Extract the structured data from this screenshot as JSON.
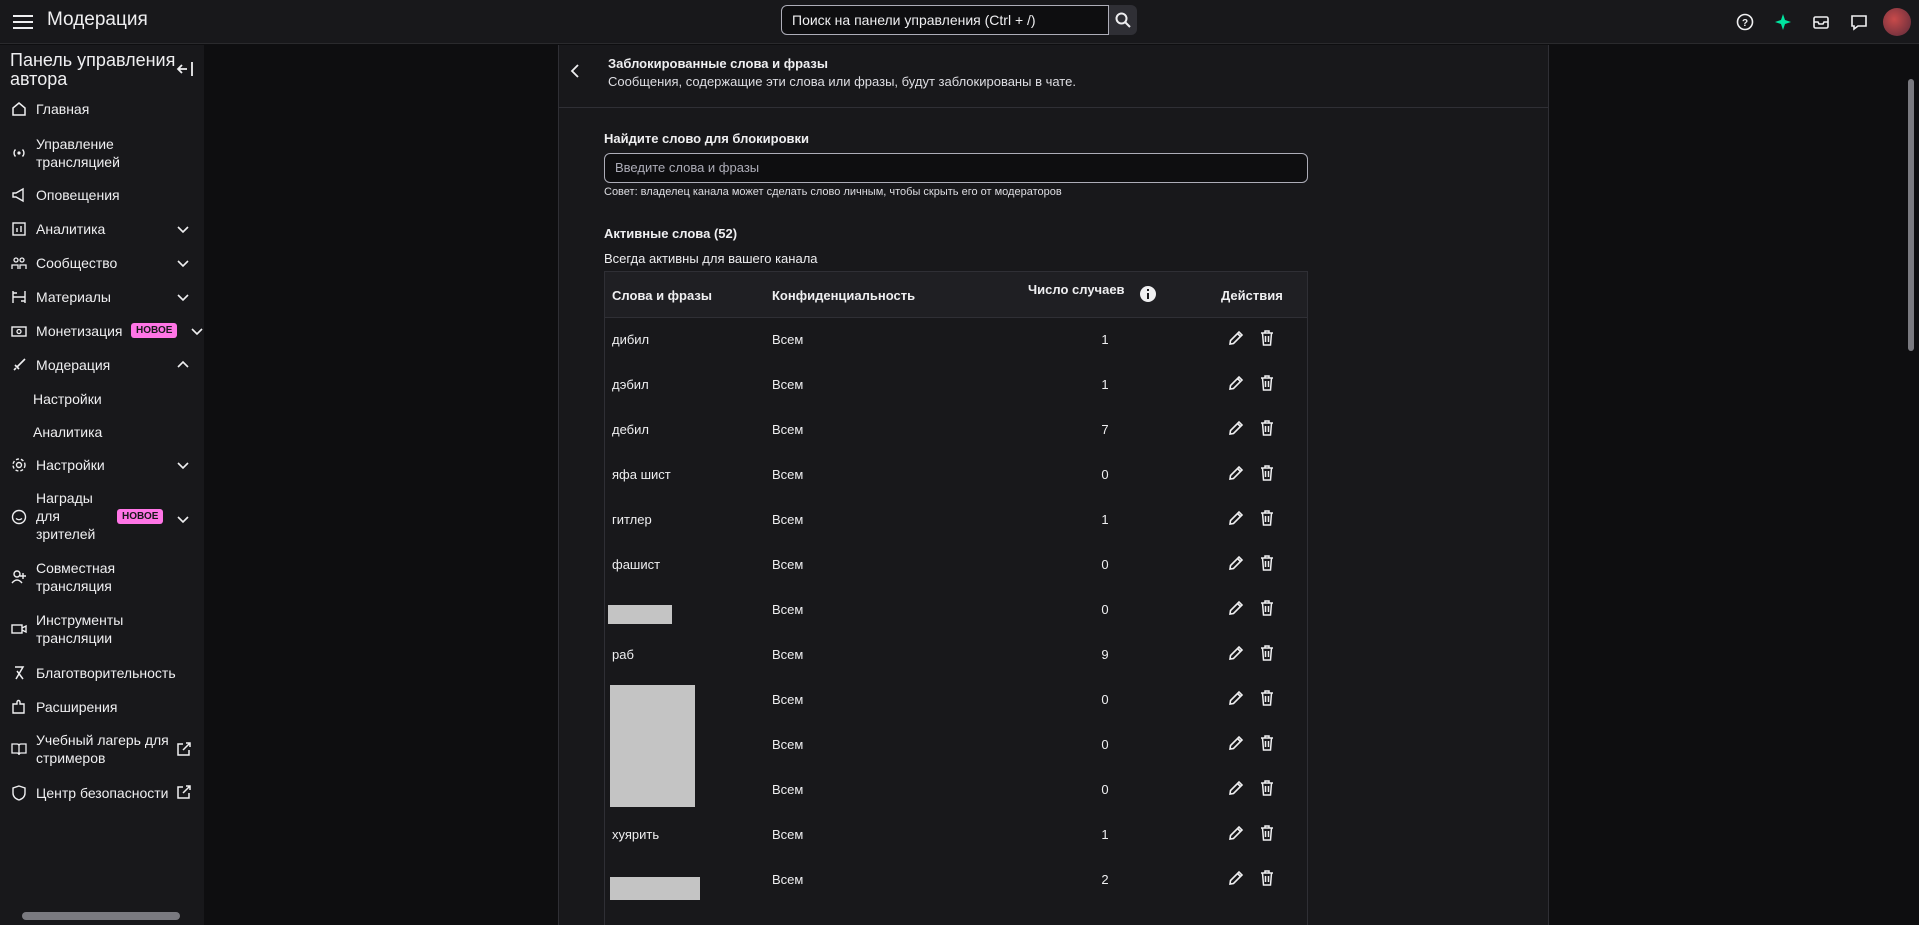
{
  "header": {
    "title": "Модерация",
    "search_placeholder": "Поиск на панели управления (Ctrl + /)",
    "icons": [
      "help-icon",
      "sparkle-icon",
      "inbox-icon",
      "whispers-icon",
      "avatar"
    ]
  },
  "sidebar": {
    "heading": "Панель управления автора",
    "items": [
      {
        "label": "Главная",
        "icon": "home-icon"
      },
      {
        "label": "Управление трансляцией",
        "icon": "broadcast-icon"
      },
      {
        "label": "Оповещения",
        "icon": "megaphone-icon"
      },
      {
        "label": "Аналитика",
        "icon": "analytics-icon"
      },
      {
        "label": "Сообщество",
        "icon": "community-icon"
      },
      {
        "label": "Материалы",
        "icon": "content-icon"
      },
      {
        "label": "Монетизация",
        "icon": "money-icon",
        "badge": "НОВОЕ"
      },
      {
        "label": "Модерация",
        "icon": "sword-icon"
      },
      {
        "label": "Настройки",
        "icon": "gear-icon"
      },
      {
        "label": "Награды для зрителей",
        "icon": "smile-icon",
        "badge": "НОВОЕ"
      },
      {
        "label": "Совместная трансляция",
        "icon": "add-user-icon"
      },
      {
        "label": "Инструменты трансляции",
        "icon": "camera-icon"
      },
      {
        "label": "Благотворительность",
        "icon": "ribbon-icon"
      },
      {
        "label": "Расширения",
        "icon": "puzzle-icon"
      },
      {
        "label": "Учебный лагерь для стримеров",
        "icon": "book-icon"
      },
      {
        "label": "Центр безопасности",
        "icon": "shield-icon"
      }
    ],
    "moderation_sub": [
      "Настройки",
      "Аналитика"
    ]
  },
  "panel": {
    "title": "Заблокированные слова и фразы",
    "subtitle": "Сообщения, содержащие эти слова или фразы, будут заблокированы в чате.",
    "find_label": "Найдите слово для блокировки",
    "input_placeholder": "Введите слова и фразы",
    "tip": "Совет: владелец канала может сделать слово личным, чтобы скрыть его от модераторов",
    "active_label": "Активные слова (52)",
    "always_active": "Всегда активны для вашего канала",
    "columns": [
      "Слова и фразы",
      "Конфиденциальность",
      "Число случаев",
      "Действия"
    ],
    "rows": [
      {
        "word": "дибил",
        "privacy": "Всем",
        "count": "1"
      },
      {
        "word": "дэбил",
        "privacy": "Всем",
        "count": "1"
      },
      {
        "word": "дебил",
        "privacy": "Всем",
        "count": "7"
      },
      {
        "word": "яфа шист",
        "privacy": "Всем",
        "count": "0"
      },
      {
        "word": "гитлер",
        "privacy": "Всем",
        "count": "1"
      },
      {
        "word": "фашист",
        "privacy": "Всем",
        "count": "0"
      },
      {
        "word": "",
        "privacy": "Всем",
        "count": "0"
      },
      {
        "word": "раб",
        "privacy": "Всем",
        "count": "9"
      },
      {
        "word": "",
        "privacy": "Всем",
        "count": "0"
      },
      {
        "word": "",
        "privacy": "Всем",
        "count": "0"
      },
      {
        "word": "",
        "privacy": "Всем",
        "count": "0"
      },
      {
        "word": "хуярить",
        "privacy": "Всем",
        "count": "1"
      },
      {
        "word": "",
        "privacy": "Всем",
        "count": "2"
      }
    ]
  }
}
